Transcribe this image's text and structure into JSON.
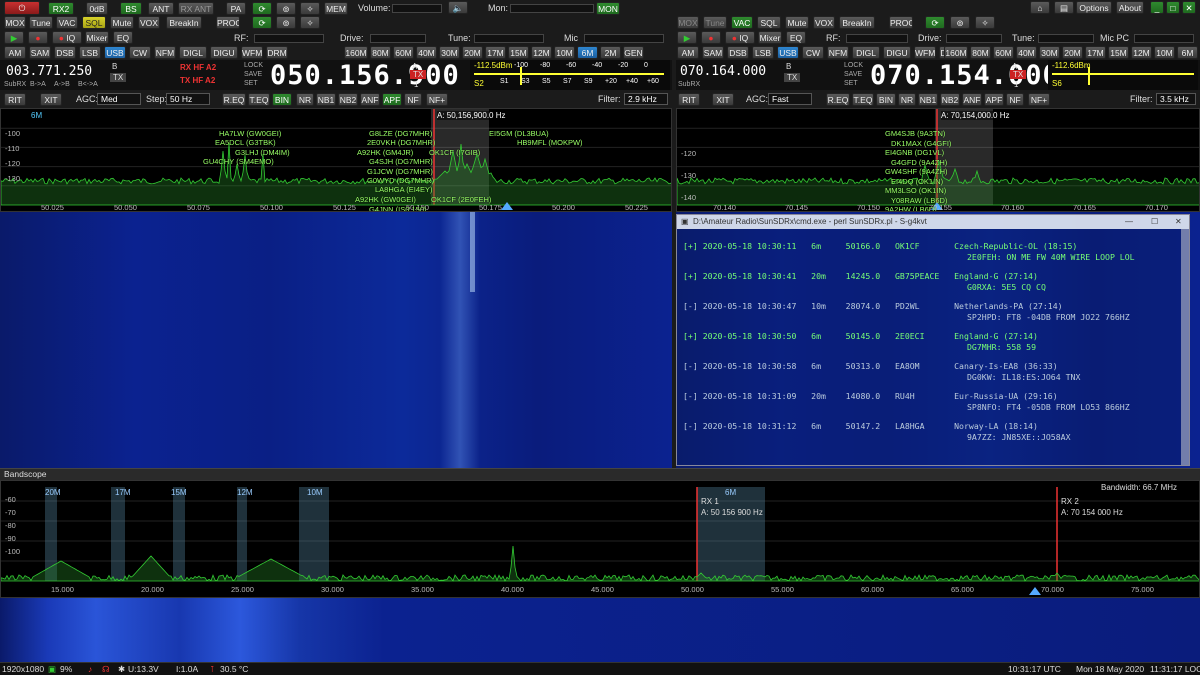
{
  "top": {
    "mox": "MOX",
    "tune": "Tune",
    "vac": "VAC",
    "sql": "SQL",
    "mute": "Mute",
    "vox": "VOX",
    "breakin": "BreakIn",
    "proc": "PROC",
    "rx2": "RX2",
    "odb": "0dB",
    "bs": "BS",
    "ant": "ANT",
    "rxant": "RX ANT",
    "pa": "PA",
    "mem": "MEM",
    "volume": "Volume:",
    "mon": "Mon:",
    "mon_btn": "MON",
    "options": "Options",
    "about": "About",
    "iq": "IQ",
    "mixer": "Mixer",
    "eq": "EQ",
    "rf": "RF:",
    "drive": "Drive:",
    "tune_lbl": "Tune:",
    "mic": "Mic",
    "micpc": "Mic PC"
  },
  "modes": [
    "AM",
    "SAM",
    "DSB",
    "LSB",
    "USB",
    "CW",
    "NFM",
    "DIGL",
    "DIGU",
    "WFM",
    "DRM"
  ],
  "bands": [
    "160M",
    "80M",
    "60M",
    "40M",
    "30M",
    "20M",
    "17M",
    "15M",
    "12M",
    "10M",
    "6M",
    "2M",
    "GEN"
  ],
  "rx1": {
    "subrx": "SubRX",
    "ab1": "B->A",
    "ab2": "A->B",
    "ab3": "B<->A",
    "sub_freq": "003.771.250",
    "b_lbl": "B",
    "tx_lbl": "TX",
    "rxhf": "RX HF  A2",
    "txhf": "TX HF  A2",
    "lock": "LOCK",
    "save": "SAVE",
    "set": "SET",
    "main_freq": "050.156.900",
    "a_lbl": "A",
    "tx_badge": "TX",
    "one": "1",
    "smeter": "-112.5dBm",
    "s_reading": "S2",
    "rit": "RIT",
    "xit": "XIT",
    "agc": "AGC:",
    "agc_val": "Med",
    "step": "Step:",
    "step_val": "50 Hz",
    "req": "R.EQ",
    "teq": "T.EQ",
    "bin": "BIN",
    "nr": "NR",
    "nb1": "NB1",
    "nb2": "NB2",
    "anf": "ANF",
    "apf": "APF",
    "nf": "NF",
    "nfplus": "NF+",
    "filter": "Filter:",
    "filter_val": "2.9 kHz",
    "band": "6M",
    "vfo_label": "A: 50,156,900.0 Hz",
    "xticks": [
      "50.025",
      "50.050",
      "50.075",
      "50.100",
      "50.125",
      "50.150",
      "50.175",
      "50.200",
      "50.225"
    ],
    "yticks": [
      "-100",
      "-110",
      "-120",
      "-130"
    ]
  },
  "rx2": {
    "subrx": "SubRX",
    "sub_freq": "070.164.000",
    "b_lbl": "B",
    "tx_lbl": "TX",
    "lock": "LOCK",
    "save": "SAVE",
    "set": "SET",
    "main_freq": "070.154.000",
    "a_lbl": "A",
    "tx_badge": "TX",
    "one": "1",
    "smeter": "-112.6dBm",
    "s_reading": "S6",
    "rit": "RIT",
    "xit": "XIT",
    "agc": "AGC:",
    "agc_val": "Fast",
    "filter": "Filter:",
    "filter_val": "3.5 kHz",
    "vfo_label": "A: 70,154,000.0 Hz",
    "xticks": [
      "70.140",
      "70.145",
      "70.150",
      "70.155",
      "70.160",
      "70.165",
      "70.170"
    ],
    "yticks": [
      "-120",
      "-130",
      "-140"
    ]
  },
  "smeter_scale": [
    "-100",
    "-80",
    "-60",
    "-40",
    "-20",
    "0"
  ],
  "smeter_scale2": [
    "S1",
    "S3",
    "S5",
    "S7",
    "S9",
    "+20",
    "+40",
    "+60"
  ],
  "spots1": [
    {
      "t": "HA7LW (GW0GEI)"
    },
    {
      "t": "EA5DCL (G3TBK)"
    },
    {
      "t": "G3LHJ (DM4IM)"
    },
    {
      "t": "GU4CHY (SM4EMO)"
    },
    {
      "t": "G8LZE (DG7MHR)"
    },
    {
      "t": "2E0VKH (DG7MHR)"
    },
    {
      "t": "A92HK (GM4JR)"
    },
    {
      "t": "G4SJH (DG7MHR)"
    },
    {
      "t": "G1JCW (DG7MHR)"
    },
    {
      "t": "G0WYD (DG7MHR)"
    },
    {
      "t": "LA8HGA (EI4EY)"
    },
    {
      "t": "A92HK (GW0GEI)"
    },
    {
      "t": "G4JNN (IS0.150)"
    },
    {
      "t": "LA8HGA (GOEWU)"
    },
    {
      "t": "2E0ECI (DG7MHR)"
    },
    {
      "t": "EI5GM (DL3BUA)"
    },
    {
      "t": "HB9MFL (MOKPW)"
    },
    {
      "t": "OK1CF (I7GIB)"
    },
    {
      "t": "OK1CF (2E0FEH)"
    }
  ],
  "spots2": [
    {
      "t": "GM4SJB (9A3TN)"
    },
    {
      "t": "DK1MAX (G4GFI)"
    },
    {
      "t": "EI4GNB (DG1VL)"
    },
    {
      "t": "G4GFD (9A4ZH)"
    },
    {
      "t": "GW4SHF (9A4ZH)"
    },
    {
      "t": "EI4DQ (OK1IN)"
    },
    {
      "t": "MM3LSO (OK1IN)"
    },
    {
      "t": "Y08RAW (LB6D)"
    },
    {
      "t": "9A2HW (LB6D)"
    },
    {
      "t": "EI4DQ (S59DV)"
    }
  ],
  "console": {
    "title": "D:\\Amateur Radio\\SunSDRx\\cmd.exe - perl SunSDRx.pl - S-g4kvt",
    "rows": [
      {
        "a": "[+] 2020-05-18 10:30:11   6m     50166.0   OK1CF       Czech-Republic-OL (18:15)",
        "b": "2E0FEH: ON ME FW 40M WIRE LOOP LOL"
      },
      {
        "a": "[+] 2020-05-18 10:30:41   20m    14245.0   GB75PEACE   England-G (27:14)",
        "b": "G0RXA: 5E5 CQ CQ"
      },
      {
        "a": "[-] 2020-05-18 10:30:47   10m    28074.0   PD2WL       Netherlands-PA (27:14)",
        "b": "SP2HPD: FT8 -04DB FROM JO22 766HZ"
      },
      {
        "a": "[+] 2020-05-18 10:30:50   6m     50145.0   2E0ECI      England-G (27:14)",
        "b": "DG7MHR: 558 59"
      },
      {
        "a": "[-] 2020-05-18 10:30:58   6m     50313.0   EA8OM       Canary-Is-EA8 (36:33)",
        "b": "DG0KW: IL18:ES:JO64 TNX"
      },
      {
        "a": "[-] 2020-05-18 10:31:09   20m    14080.0   RU4H        Eur-Russia-UA (29:16)",
        "b": "SP8NFO: FT4 -05DB FROM LO53 866HZ"
      },
      {
        "a": "[-] 2020-05-18 10:31:12   6m     50147.2   LA8HGA      Norway-LA (18:14)",
        "b": "9A7ZZ: JN85XE::JO58AX"
      }
    ]
  },
  "bandscope": {
    "title": "Bandscope",
    "bandwidth": "Bandwidth: 66.7 MHz",
    "bands": [
      "20M",
      "17M",
      "15M",
      "12M",
      "10M",
      "6M"
    ],
    "rx1": "RX 1",
    "rx1_freq": "A: 50 156 900 Hz",
    "rx2": "RX 2",
    "rx2_freq": "A: 70 154 000 Hz",
    "xticks": [
      "15.000",
      "20.000",
      "25.000",
      "30.000",
      "35.000",
      "40.000",
      "45.000",
      "50.000",
      "55.000",
      "60.000",
      "65.000",
      "70.000",
      "75.000"
    ],
    "yticks": [
      "-60",
      "-70",
      "-80",
      "-90",
      "-100"
    ]
  },
  "status": {
    "res": "1920x1080",
    "cpu": "9%",
    "u": "U:13.3V",
    "i": "I:1.0A",
    "temp": "30.5 °C",
    "utc": "10:31:17 UTC",
    "date": "Mon 18 May 2020",
    "loc": "11:31:17 LOC"
  },
  "smeter_marks": [
    "S5",
    "S9",
    "20",
    "40"
  ]
}
